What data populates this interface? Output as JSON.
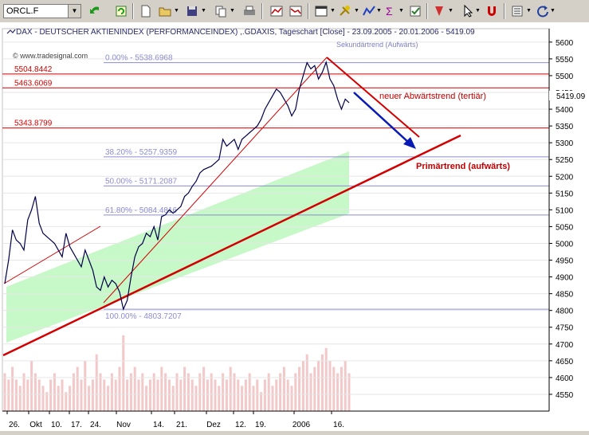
{
  "toolbar": {
    "symbol_value": "ORCL.F"
  },
  "icons": [
    "undo-arrow-icon",
    "refresh-icon",
    "new-document-icon",
    "open-folder-icon",
    "save-disk-icon",
    "copy-icon",
    "print-icon",
    "chart-compare-icon",
    "chart-arrow-icon",
    "window-icon",
    "tools-icon",
    "indicator-icon",
    "formula-icon",
    "properties-icon",
    "mark-icon",
    "cursor-icon",
    "magnet-icon",
    "list-icon",
    "redo-circle-icon"
  ],
  "chart": {
    "title": "DAX  - DEUTSCHER AKTIENINDEX (PERFORMANCEINDEX) ,.GDAXIS, Tageschart [Close] - 23.09.2005 - 20.01.2006 - 5419.09",
    "watermark": "© www.tradesignal.com",
    "last_value": "5419.09",
    "secondary_trend_label": "Sekundärtrend (Aufwärts)",
    "new_trend_label": "neuer Abwärtstrend (tertiär)",
    "primary_trend_label": "Primärtrend (aufwärts)",
    "colors": {
      "price_line": "#00004a",
      "red": "#d20000",
      "blue_arrow": "#0a1ab4",
      "fib": "#8c8cd2",
      "channel": "#b4f5b4",
      "volume": "#f2c8c8"
    }
  },
  "chart_data": {
    "type": "line",
    "title": "DAX  - DEUTSCHER AKTIENINDEX (PERFORMANCEINDEX) ,.GDAXIS, Tageschart [Close] - 23.09.2005 - 20.01.2006 - 5419.09",
    "ylim": [
      4500,
      5640
    ],
    "y_ticks": [
      4550,
      4600,
      4650,
      4700,
      4750,
      4800,
      4850,
      4900,
      4950,
      5000,
      5050,
      5100,
      5150,
      5200,
      5250,
      5300,
      5350,
      5400,
      5450,
      5500,
      5550,
      5600
    ],
    "x_tick_labels": [
      "26.",
      "Okt",
      "10.",
      "17.",
      "24.",
      "Nov",
      "14.",
      "21.",
      "Dez",
      "12.",
      "19.",
      "2006",
      "16."
    ],
    "series": [
      {
        "values": [
          4880,
          4950,
          5040,
          5010,
          5000,
          4980,
          5070,
          5100,
          5140,
          5060,
          5030,
          5020,
          5010,
          5000,
          4980,
          4960,
          5030,
          4990,
          4970,
          4950,
          4930,
          4980,
          4950,
          4920,
          4870,
          4860,
          4900,
          4870,
          4890,
          4880,
          4855,
          4803.72,
          4830,
          4900,
          4960,
          4990,
          5000,
          5030,
          5020,
          5050,
          5010,
          5080,
          5085,
          5100,
          5090,
          5100,
          5110,
          5140,
          5150,
          5170,
          5185,
          5210,
          5220,
          5225,
          5230,
          5240,
          5250,
          5310,
          5290,
          5300,
          5310,
          5280,
          5310,
          5320,
          5330,
          5340,
          5350,
          5370,
          5400,
          5420,
          5440,
          5460,
          5450,
          5430,
          5410,
          5380,
          5400,
          5460,
          5500,
          5538.7,
          5520,
          5530,
          5490,
          5510,
          5540,
          5490,
          5470,
          5430,
          5400,
          5430,
          5419.09
        ]
      }
    ],
    "horizontal_lines": [
      {
        "label": "5504.8442",
        "value": 5504.8442
      },
      {
        "label": "5463.6069",
        "value": 5463.6069
      },
      {
        "label": "5343.8799",
        "value": 5343.8799
      }
    ],
    "fibonacci": [
      {
        "label": "0.00% - 5538.6968",
        "value": 5538.6968
      },
      {
        "label": "38.20% - 5257.9359",
        "value": 5257.9359
      },
      {
        "label": "50.00% - 5171.2087",
        "value": 5171.2087
      },
      {
        "label": "61.80% - 5084.4816",
        "value": 5084.4816
      },
      {
        "label": "100.00% - 4803.7207",
        "value": 4803.7207
      }
    ],
    "volume": [
      6,
      5,
      7,
      5,
      4,
      6,
      5,
      8,
      6,
      5,
      4,
      3,
      5,
      6,
      4,
      5,
      3,
      4,
      6,
      7,
      5,
      8,
      4,
      5,
      9,
      6,
      5,
      4,
      6,
      5,
      7,
      12,
      5,
      6,
      7,
      5,
      6,
      4,
      5,
      6,
      5,
      7,
      6,
      5,
      4,
      6,
      5,
      7,
      6,
      5,
      4,
      6,
      7,
      5,
      6,
      5,
      4,
      6,
      5,
      7,
      6,
      5,
      4,
      5,
      6,
      4,
      5,
      3,
      5,
      6,
      4,
      5,
      6,
      7,
      5,
      4,
      6,
      7,
      8,
      9,
      6,
      7,
      8,
      9,
      10,
      8,
      7,
      6,
      7,
      8,
      6
    ],
    "grid": true,
    "legend": "none"
  }
}
